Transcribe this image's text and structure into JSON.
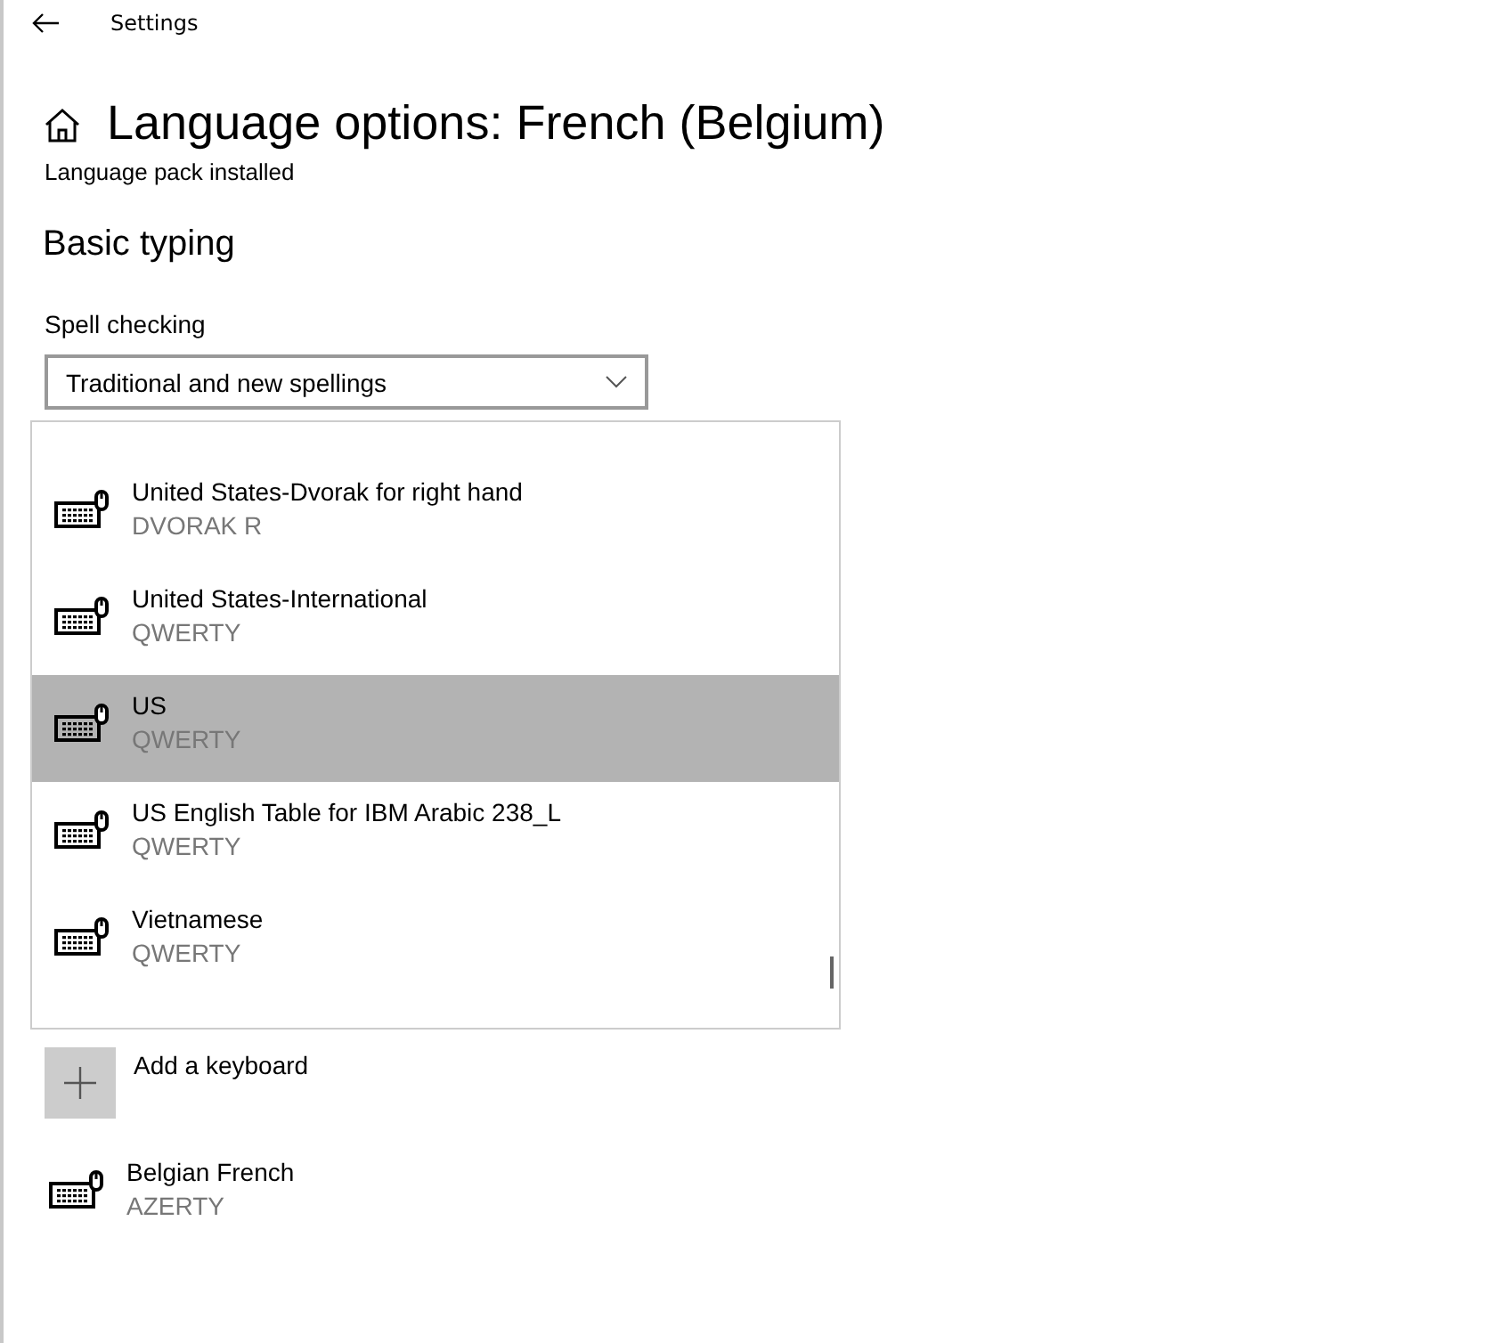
{
  "window": {
    "title": "Settings"
  },
  "page": {
    "title": "Language options: French (Belgium)",
    "status": "Language pack installed"
  },
  "section": {
    "title": "Basic typing"
  },
  "spell_checking": {
    "label": "Spell checking",
    "value": "Traditional and new spellings"
  },
  "dropdown_list": {
    "items": [
      {
        "name": "United States-Dvorak for right hand",
        "layout": "DVORAK R",
        "selected": false
      },
      {
        "name": "United States-International",
        "layout": "QWERTY",
        "selected": false
      },
      {
        "name": "US",
        "layout": "QWERTY",
        "selected": true
      },
      {
        "name": "US English Table for IBM Arabic 238_L",
        "layout": "QWERTY",
        "selected": false
      },
      {
        "name": "Vietnamese",
        "layout": "QWERTY",
        "selected": false
      }
    ]
  },
  "add_keyboard": {
    "label": "Add a keyboard"
  },
  "keyboards": [
    {
      "name": "Belgian French",
      "layout": "AZERTY"
    }
  ]
}
